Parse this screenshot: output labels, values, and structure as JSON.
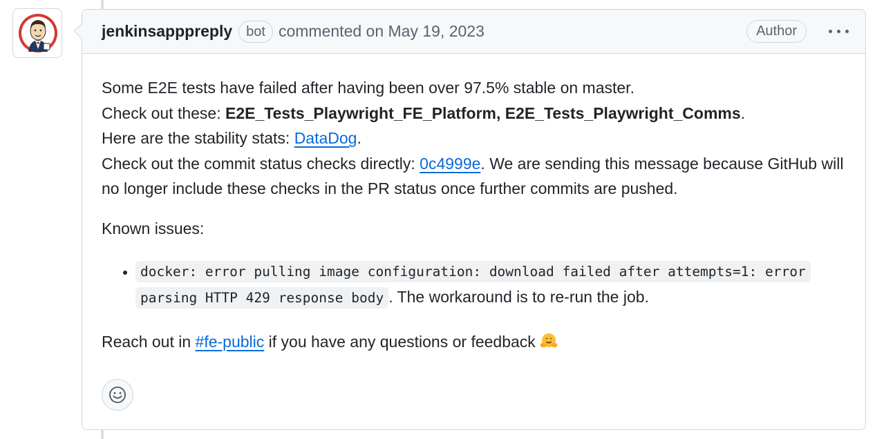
{
  "comment": {
    "author": "jenkinsapppreply",
    "bot_badge": "bot",
    "meta": "commented on May 19, 2023",
    "author_label": "Author",
    "menu_icon": "kebab-horizontal-icon",
    "avatar_icon": "jenkins-butler-avatar",
    "reaction_icon": "smiley-icon",
    "body": {
      "line1": "Some E2E tests have failed after having been over 97.5% stable on master.",
      "line2_prefix": "Check out these: ",
      "line2_bold": "E2E_Tests_Playwright_FE_Platform, E2E_Tests_Playwright_Comms",
      "line2_suffix": ".",
      "line3_prefix": "Here are the stability stats: ",
      "line3_link": "DataDog",
      "line3_suffix": ".",
      "line4_prefix": "Check out the commit status checks directly: ",
      "line4_link": "0c4999e",
      "line4_suffix": ". We are sending this message because GitHub will no longer include these checks in the PR status once further commits are pushed.",
      "known_issues": "Known issues:",
      "issue_code": "docker: error pulling image configuration: download failed after attempts=1: error parsing HTTP 429 response body",
      "issue_suffix": ". The workaround is to re-run the job.",
      "reach_prefix": "Reach out in ",
      "reach_link": "#fe-public",
      "reach_suffix": " if you have any questions or feedback ",
      "reach_emoji": "hugging-face-emoji"
    }
  },
  "colors": {
    "link": "#0969da",
    "border": "#d0d7de",
    "header_bg": "#f6f8fa",
    "muted_text": "#59636e",
    "jenkins_red": "#d33833"
  }
}
